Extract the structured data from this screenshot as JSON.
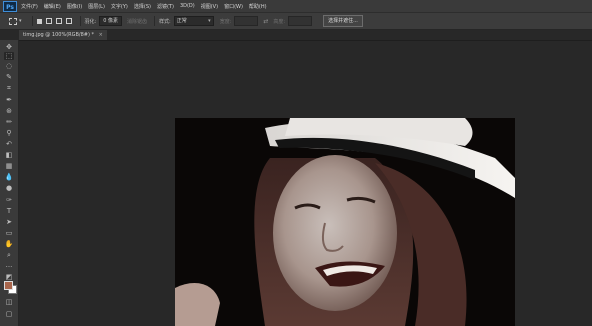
{
  "app": {
    "logo_text": "Ps"
  },
  "menu": {
    "items": [
      {
        "label": "文件(F)"
      },
      {
        "label": "编辑(E)"
      },
      {
        "label": "图像(I)"
      },
      {
        "label": "图层(L)"
      },
      {
        "label": "文字(Y)"
      },
      {
        "label": "选择(S)"
      },
      {
        "label": "滤镜(T)"
      },
      {
        "label": "3D(D)"
      },
      {
        "label": "视图(V)"
      },
      {
        "label": "窗口(W)"
      },
      {
        "label": "帮助(H)"
      }
    ]
  },
  "options": {
    "feather_label": "羽化:",
    "feather_value": "0 像素",
    "antialias_label": "消除锯齿",
    "style_label": "样式:",
    "style_value": "正常",
    "width_label": "宽度:",
    "height_label": "高度:",
    "select_mask_button": "选择并遮住..."
  },
  "document": {
    "tab_title": "timg.jpg @ 100%(RGB/8#) *",
    "close_glyph": "×"
  },
  "tools": [
    {
      "name": "move-tool",
      "glyph": "✥"
    },
    {
      "name": "rectangular-marquee-tool",
      "glyph": "⬚"
    },
    {
      "name": "lasso-tool",
      "glyph": "◌"
    },
    {
      "name": "quick-selection-tool",
      "glyph": "✎"
    },
    {
      "name": "crop-tool",
      "glyph": "⌗"
    },
    {
      "name": "eyedropper-tool",
      "glyph": "✒"
    },
    {
      "name": "spot-healing-tool",
      "glyph": "⊛"
    },
    {
      "name": "brush-tool",
      "glyph": "✏"
    },
    {
      "name": "clone-stamp-tool",
      "glyph": "⚲"
    },
    {
      "name": "history-brush-tool",
      "glyph": "↶"
    },
    {
      "name": "eraser-tool",
      "glyph": "◧"
    },
    {
      "name": "gradient-tool",
      "glyph": "▦"
    },
    {
      "name": "blur-tool",
      "glyph": "💧"
    },
    {
      "name": "dodge-tool",
      "glyph": "●"
    },
    {
      "name": "pen-tool",
      "glyph": "✑"
    },
    {
      "name": "type-tool",
      "glyph": "T"
    },
    {
      "name": "path-selection-tool",
      "glyph": "➤"
    },
    {
      "name": "rectangle-tool",
      "glyph": "▭"
    },
    {
      "name": "hand-tool",
      "glyph": "✋"
    },
    {
      "name": "zoom-tool",
      "glyph": "⌕"
    },
    {
      "name": "more-tools",
      "glyph": "···"
    },
    {
      "name": "reset-colors",
      "glyph": "◩"
    }
  ],
  "colors": {
    "foreground": "#a9664c",
    "background": "#ffffff"
  }
}
